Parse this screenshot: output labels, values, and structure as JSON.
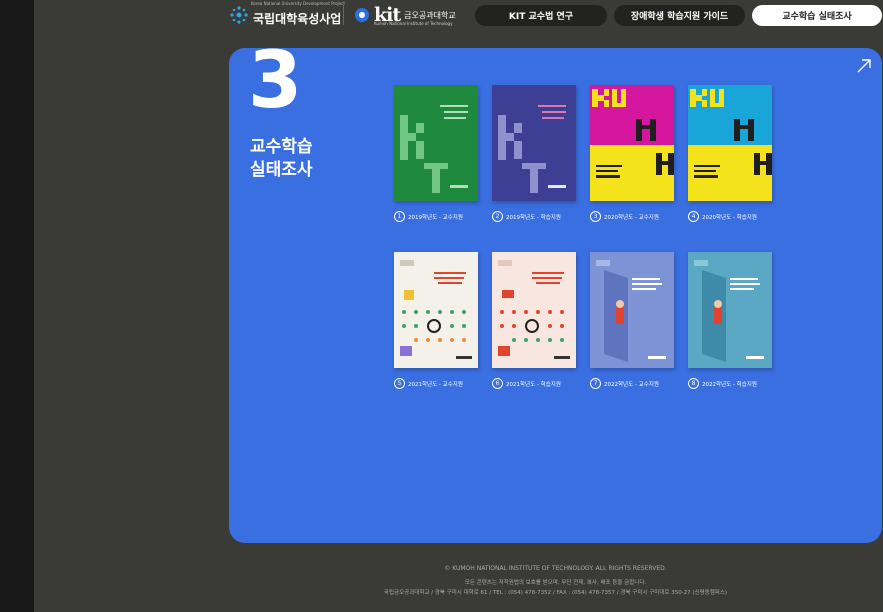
{
  "header": {
    "logo1_small": "Korea National University Development Project",
    "logo1_text": "국립대학육성사업",
    "logo2_mark": "kit",
    "logo2_name": "금오공과대학교",
    "logo2_sub": "Kumoh National Institute of Technology",
    "nav": [
      {
        "label": "KIT 교수법 연구",
        "active": false
      },
      {
        "label": "장애학생 학습지원 가이드",
        "active": false
      },
      {
        "label": "교수학습 실태조사",
        "active": true
      }
    ]
  },
  "panel": {
    "number": "3",
    "title_line1": "교수학습",
    "title_line2": "실태조사",
    "reports": [
      {
        "num": "1",
        "label": "2019학년도 - 교수지원"
      },
      {
        "num": "2",
        "label": "2019학년도 - 학습지원"
      },
      {
        "num": "3",
        "label": "2020학년도 - 교수지원"
      },
      {
        "num": "4",
        "label": "2020학년도 - 학습지원"
      },
      {
        "num": "5",
        "label": "2021학년도 - 교수지원"
      },
      {
        "num": "6",
        "label": "2021학년도 - 학습지원"
      },
      {
        "num": "7",
        "label": "2022학년도 - 교수지원"
      },
      {
        "num": "8",
        "label": "2022학년도 - 학습지원"
      }
    ]
  },
  "footer": {
    "copyright": "© KUMOH NATIONAL INSTITUTE OF TECHNOLOGY. ALL RIGHTS RESERVED.",
    "notice": "모든 콘텐츠는 저작권법의 보호를 받으며, 무단 전재, 복사, 배포 등을 금합니다.",
    "address": "국립금오공과대학교 / 경북 구미시 대학로 61 / TEL : (054) 478-7352 / FAX : (054) 478-7357 / 경북 구미시 구미대로 350-27 (신평동캠퍼스)"
  },
  "colors": {
    "panel": "#3a6fe2",
    "background": "#3a3a37",
    "cover_green": "#1f8a3e",
    "cover_purple": "#3c3f94",
    "cover_magenta": "#d4179e",
    "cover_cyan": "#1aa5d8",
    "cover_yellow": "#f4e21a",
    "cover_cream": "#f4f1ea",
    "cover_pink": "#f8e6e0",
    "cover_slate": "#7e93d6",
    "cover_teal": "#5aa8c4"
  },
  "icons": {
    "arrow": "arrow-up-right-icon",
    "logo1": "starburst-logo-icon",
    "logo2": "kit-logo-icon"
  }
}
